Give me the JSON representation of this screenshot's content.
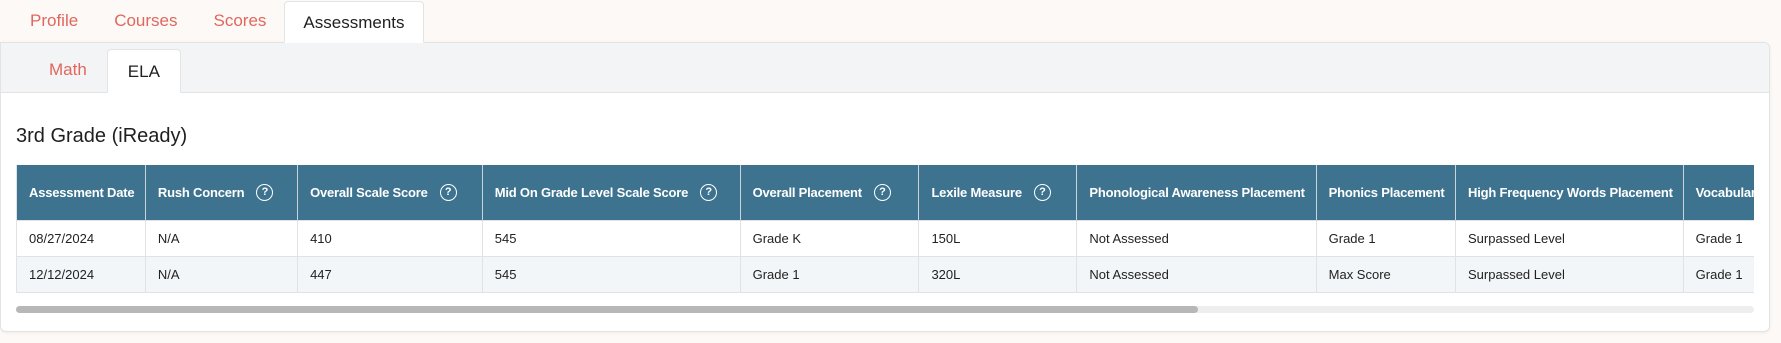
{
  "top_tabs": [
    {
      "label": "Profile"
    },
    {
      "label": "Courses"
    },
    {
      "label": "Scores"
    },
    {
      "label": "Assessments"
    }
  ],
  "sub_tabs": [
    {
      "label": "Math"
    },
    {
      "label": "ELA"
    }
  ],
  "section_title": "3rd Grade (iReady)",
  "table": {
    "headers": [
      "Assessment Date",
      "Rush Concern",
      "Overall Scale Score",
      "Mid On Grade Level Scale Score",
      "Overall Placement",
      "Lexile Measure",
      "Phonological Awareness Placement",
      "Phonics Placement",
      "High Frequency Words Placement",
      "Vocabulary Placement"
    ],
    "rows": [
      [
        "08/27/2024",
        "N/A",
        "410",
        "545",
        "Grade K",
        "150L",
        "Not Assessed",
        "Grade 1",
        "Surpassed Level",
        "Grade 1"
      ],
      [
        "12/12/2024",
        "N/A",
        "447",
        "545",
        "Grade 1",
        "320L",
        "Not Assessed",
        "Max Score",
        "Surpassed Level",
        "Grade 1"
      ]
    ],
    "help_icon_symbol": "?"
  },
  "colors": {
    "accent": "#e0675d",
    "header_bg": "#3e7390"
  },
  "icons": {
    "help": "question-circle-icon"
  }
}
